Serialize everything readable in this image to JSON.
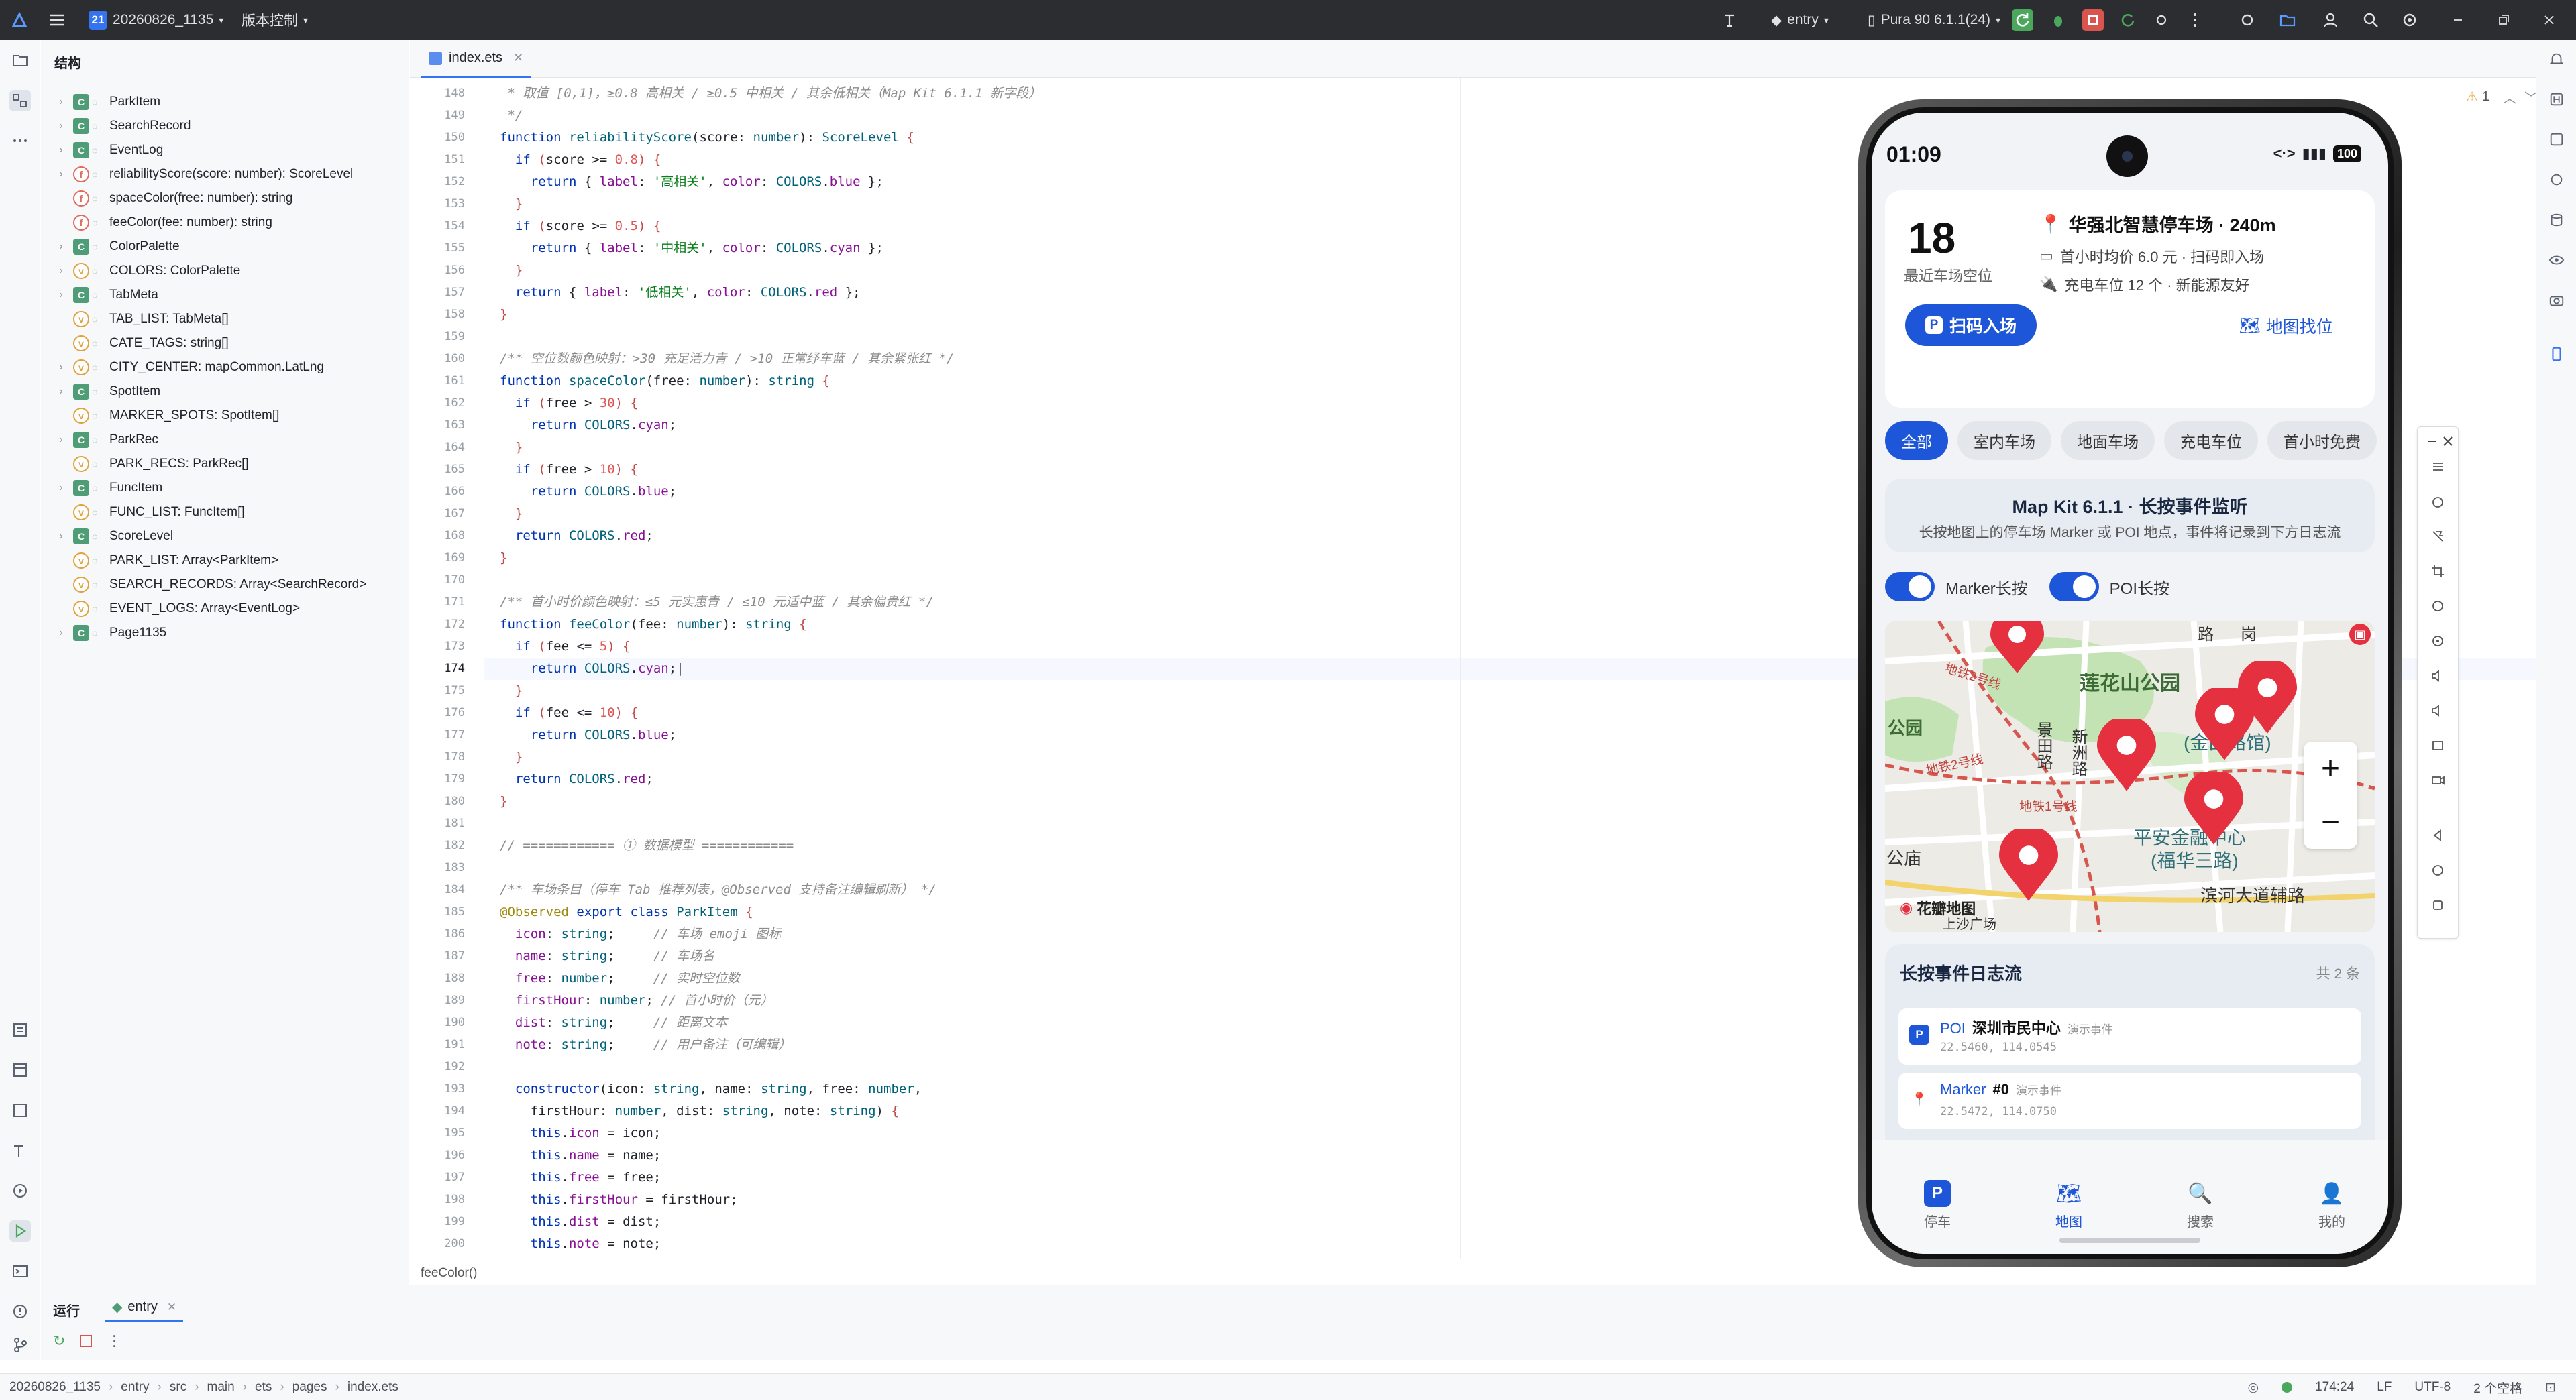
{
  "titlebar": {
    "project_badge": "21",
    "project_name": "20260826_1135",
    "vcs_label": "版本控制",
    "run_config": "entry",
    "device": "Pura 90 6.1.1(24)"
  },
  "structure": {
    "title": "结构",
    "items": [
      {
        "kind": "class",
        "expandable": true,
        "label": "ParkItem"
      },
      {
        "kind": "class",
        "expandable": true,
        "label": "SearchRecord"
      },
      {
        "kind": "class",
        "expandable": true,
        "label": "EventLog"
      },
      {
        "kind": "func",
        "expandable": true,
        "label": "reliabilityScore(score: number): ScoreLevel"
      },
      {
        "kind": "func",
        "expandable": false,
        "label": "spaceColor(free: number): string"
      },
      {
        "kind": "func",
        "expandable": false,
        "label": "feeColor(fee: number): string"
      },
      {
        "kind": "class",
        "expandable": true,
        "label": "ColorPalette"
      },
      {
        "kind": "var",
        "expandable": true,
        "label": "COLORS: ColorPalette"
      },
      {
        "kind": "class",
        "expandable": true,
        "label": "TabMeta"
      },
      {
        "kind": "var",
        "expandable": false,
        "label": "TAB_LIST: TabMeta[]"
      },
      {
        "kind": "var",
        "expandable": false,
        "label": "CATE_TAGS: string[]"
      },
      {
        "kind": "var",
        "expandable": true,
        "label": "CITY_CENTER: mapCommon.LatLng"
      },
      {
        "kind": "class",
        "expandable": true,
        "label": "SpotItem"
      },
      {
        "kind": "var",
        "expandable": false,
        "label": "MARKER_SPOTS: SpotItem[]"
      },
      {
        "kind": "class",
        "expandable": true,
        "label": "ParkRec"
      },
      {
        "kind": "var",
        "expandable": false,
        "label": "PARK_RECS: ParkRec[]"
      },
      {
        "kind": "class",
        "expandable": true,
        "label": "FuncItem"
      },
      {
        "kind": "var",
        "expandable": false,
        "label": "FUNC_LIST: FuncItem[]"
      },
      {
        "kind": "class",
        "expandable": true,
        "label": "ScoreLevel"
      },
      {
        "kind": "var",
        "expandable": false,
        "label": "PARK_LIST: Array<ParkItem>"
      },
      {
        "kind": "var",
        "expandable": false,
        "label": "SEARCH_RECORDS: Array<SearchRecord>"
      },
      {
        "kind": "var",
        "expandable": false,
        "label": "EVENT_LOGS: Array<EventLog>"
      },
      {
        "kind": "class",
        "expandable": true,
        "label": "Page1135"
      }
    ]
  },
  "editor": {
    "tab": "index.ets",
    "current_line": 174,
    "footer_hint": "feeColor()",
    "warning_count": "1",
    "lines": [
      {
        "n": 148,
        "html": "<span class=\"cm\"> * 取值 [0,1]，≥0.8 高相关 / ≥0.5 中相关 / 其余低相关（Map Kit 6.1.1 新字段）</span>"
      },
      {
        "n": 149,
        "html": "<span class=\"cm\"> */</span>"
      },
      {
        "n": 150,
        "html": "<span class=\"k\">function</span> <span class=\"fn\">reliabilityScore</span>(score: <span class=\"ty\">number</span>): <span class=\"ty\">ScoreLevel</span> <span class=\"bk\">{</span>"
      },
      {
        "n": 151,
        "html": "  <span class=\"k\">if</span> <span class=\"bk\">(</span>score &gt;= <span class=\"nm\">0.8</span><span class=\"bk\">)</span> <span class=\"bk\">{</span>"
      },
      {
        "n": 152,
        "html": "    <span class=\"k\">return</span> { <span class=\"pr\">label</span>: <span class=\"st\">'高相关'</span>, <span class=\"pr\">color</span>: <span class=\"ty\">COLORS</span>.<span class=\"pr\">blue</span> };"
      },
      {
        "n": 153,
        "html": "  <span class=\"bk\">}</span>"
      },
      {
        "n": 154,
        "html": "  <span class=\"k\">if</span> <span class=\"bk\">(</span>score &gt;= <span class=\"nm\">0.5</span><span class=\"bk\">)</span> <span class=\"bk\">{</span>"
      },
      {
        "n": 155,
        "html": "    <span class=\"k\">return</span> { <span class=\"pr\">label</span>: <span class=\"st\">'中相关'</span>, <span class=\"pr\">color</span>: <span class=\"ty\">COLORS</span>.<span class=\"pr\">cyan</span> };"
      },
      {
        "n": 156,
        "html": "  <span class=\"bk\">}</span>"
      },
      {
        "n": 157,
        "html": "  <span class=\"k\">return</span> { <span class=\"pr\">label</span>: <span class=\"st\">'低相关'</span>, <span class=\"pr\">color</span>: <span class=\"ty\">COLORS</span>.<span class=\"pr\">red</span> };"
      },
      {
        "n": 158,
        "html": "<span class=\"bk\">}</span>"
      },
      {
        "n": 159,
        "html": ""
      },
      {
        "n": 160,
        "html": "<span class=\"cm\">/** 空位数颜色映射：&gt;30 充足活力青 / &gt;10 正常纾车蓝 / 其余紧张红 */</span>"
      },
      {
        "n": 161,
        "html": "<span class=\"k\">function</span> <span class=\"fn\">spaceColor</span>(free: <span class=\"ty\">number</span>): <span class=\"ty\">string</span> <span class=\"bk\">{</span>"
      },
      {
        "n": 162,
        "html": "  <span class=\"k\">if</span> <span class=\"bk\">(</span>free &gt; <span class=\"nm\">30</span><span class=\"bk\">)</span> <span class=\"bk\">{</span>"
      },
      {
        "n": 163,
        "html": "    <span class=\"k\">return</span> <span class=\"ty\">COLORS</span>.<span class=\"pr\">cyan</span>;"
      },
      {
        "n": 164,
        "html": "  <span class=\"bk\">}</span>"
      },
      {
        "n": 165,
        "html": "  <span class=\"k\">if</span> <span class=\"bk\">(</span>free &gt; <span class=\"nm\">10</span><span class=\"bk\">)</span> <span class=\"bk\">{</span>"
      },
      {
        "n": 166,
        "html": "    <span class=\"k\">return</span> <span class=\"ty\">COLORS</span>.<span class=\"pr\">blue</span>;"
      },
      {
        "n": 167,
        "html": "  <span class=\"bk\">}</span>"
      },
      {
        "n": 168,
        "html": "  <span class=\"k\">return</span> <span class=\"ty\">COLORS</span>.<span class=\"pr\">red</span>;"
      },
      {
        "n": 169,
        "html": "<span class=\"bk\">}</span>"
      },
      {
        "n": 170,
        "html": ""
      },
      {
        "n": 171,
        "html": "<span class=\"cm\">/** 首小时价颜色映射：≤5 元实惠青 / ≤10 元适中蓝 / 其余偏贵红 */</span>"
      },
      {
        "n": 172,
        "html": "<span class=\"k\">function</span> <span class=\"fn\">feeColor</span>(fee: <span class=\"ty\">number</span>): <span class=\"ty\">string</span> <span class=\"bk\">{</span>"
      },
      {
        "n": 173,
        "html": "  <span class=\"k\">if</span> <span class=\"bk\">(</span>fee &lt;= <span class=\"nm\">5</span><span class=\"bk\">)</span> <span class=\"bk\">{</span>"
      },
      {
        "n": 174,
        "html": "    <span class=\"k\">return</span> <span class=\"ty\">COLORS</span>.<span class=\"pr\">cyan</span>;|"
      },
      {
        "n": 175,
        "html": "  <span class=\"bk\">}</span>"
      },
      {
        "n": 176,
        "html": "  <span class=\"k\">if</span> <span class=\"bk\">(</span>fee &lt;= <span class=\"nm\">10</span><span class=\"bk\">)</span> <span class=\"bk\">{</span>"
      },
      {
        "n": 177,
        "html": "    <span class=\"k\">return</span> <span class=\"ty\">COLORS</span>.<span class=\"pr\">blue</span>;"
      },
      {
        "n": 178,
        "html": "  <span class=\"bk\">}</span>"
      },
      {
        "n": 179,
        "html": "  <span class=\"k\">return</span> <span class=\"ty\">COLORS</span>.<span class=\"pr\">red</span>;"
      },
      {
        "n": 180,
        "html": "<span class=\"bk\">}</span>"
      },
      {
        "n": 181,
        "html": ""
      },
      {
        "n": 182,
        "html": "<span class=\"cm\">// ============ ① 数据模型 ============</span>"
      },
      {
        "n": 183,
        "html": ""
      },
      {
        "n": 184,
        "html": "<span class=\"cm\">/** 车场条目（停车 Tab 推荐列表，@Observed 支持备注编辑刷新） */</span>"
      },
      {
        "n": 185,
        "html": "<span class=\"dc\">@Observed</span> <span class=\"k\">export class</span> <span class=\"fn\">ParkItem</span> <span class=\"bk\">{</span>"
      },
      {
        "n": 186,
        "html": "  <span class=\"pr\">icon</span>: <span class=\"ty\">string</span>;     <span class=\"cm\">// 车场 emoji 图标</span>"
      },
      {
        "n": 187,
        "html": "  <span class=\"pr\">name</span>: <span class=\"ty\">string</span>;     <span class=\"cm\">// 车场名</span>"
      },
      {
        "n": 188,
        "html": "  <span class=\"pr\">free</span>: <span class=\"ty\">number</span>;     <span class=\"cm\">// 实时空位数</span>"
      },
      {
        "n": 189,
        "html": "  <span class=\"pr\">firstHour</span>: <span class=\"ty\">number</span>; <span class=\"cm\">// 首小时价（元）</span>"
      },
      {
        "n": 190,
        "html": "  <span class=\"pr\">dist</span>: <span class=\"ty\">string</span>;     <span class=\"cm\">// 距离文本</span>"
      },
      {
        "n": 191,
        "html": "  <span class=\"pr\">note</span>: <span class=\"ty\">string</span>;     <span class=\"cm\">// 用户备注（可编辑）</span>"
      },
      {
        "n": 192,
        "html": ""
      },
      {
        "n": 193,
        "html": "  <span class=\"k\">constructor</span>(icon: <span class=\"ty\">string</span>, name: <span class=\"ty\">string</span>, free: <span class=\"ty\">number</span>,"
      },
      {
        "n": 194,
        "html": "    firstHour: <span class=\"ty\">number</span>, dist: <span class=\"ty\">string</span>, note: <span class=\"ty\">string</span>) <span class=\"bk\">{</span>"
      },
      {
        "n": 195,
        "html": "    <span class=\"k\">this</span>.<span class=\"pr\">icon</span> = icon;"
      },
      {
        "n": 196,
        "html": "    <span class=\"k\">this</span>.<span class=\"pr\">name</span> = name;"
      },
      {
        "n": 197,
        "html": "    <span class=\"k\">this</span>.<span class=\"pr\">free</span> = free;"
      },
      {
        "n": 198,
        "html": "    <span class=\"k\">this</span>.<span class=\"pr\">firstHour</span> = firstHour;"
      },
      {
        "n": 199,
        "html": "    <span class=\"k\">this</span>.<span class=\"pr\">dist</span> = dist;"
      },
      {
        "n": 200,
        "html": "    <span class=\"k\">this</span>.<span class=\"pr\">note</span> = note;"
      }
    ]
  },
  "run": {
    "title": "运行",
    "tab": "entry"
  },
  "statusbar": {
    "crumbs": [
      "20260826_1135",
      "entry",
      "src",
      "main",
      "ets",
      "pages",
      "index.ets"
    ],
    "position": "174:24",
    "line_sep": "LF",
    "encoding": "UTF-8",
    "indent": "2 个空格"
  },
  "phone": {
    "time": "01:09",
    "battery": "100",
    "hero": {
      "free_count": "18",
      "free_label": "最近车场空位",
      "lot_name": "华强北智慧停车场 · 240m",
      "price_line": "首小时均价 6.0 元 · 扫码即入场",
      "charge_line": "充电车位 12 个 · 新能源友好",
      "scan_button": "扫码入场",
      "map_find": "地图找位"
    },
    "chips": [
      "全部",
      "室内车场",
      "地面车场",
      "充电车位",
      "首小时免费"
    ],
    "banner": {
      "title": "Map Kit 6.1.1 · 长按事件监听",
      "subtitle": "长按地图上的停车场 Marker 或 POI 地点，事件将记录到下方日志流"
    },
    "toggles": [
      "Marker长按",
      "POI长按"
    ],
    "map": {
      "labels": [
        "莲花山公园",
        "香蜜湖公园",
        "地铁2号线",
        "地铁1号线",
        "平安金融中心",
        "(福华三路)",
        "滨河大道辅路",
        "深圳美术馆",
        "(金田路馆)",
        "景田路",
        "新洲路",
        "上沙广场",
        "公庙",
        "岗",
        "路"
      ],
      "logo": "花瓣地图",
      "zoom_in": "+",
      "zoom_out": "−"
    },
    "log": {
      "title": "长按事件日志流",
      "count": "共 2 条",
      "items": [
        {
          "kind": "POI",
          "name": "深圳市民中心",
          "tag": "演示事件",
          "coords": "22.5460, 114.0545"
        },
        {
          "kind": "Marker",
          "name": "#0",
          "tag": "演示事件",
          "coords": "22.5472, 114.0750"
        }
      ]
    },
    "tabs": [
      {
        "label": "停车",
        "icon": "parking-icon"
      },
      {
        "label": "地图",
        "icon": "map-icon"
      },
      {
        "label": "搜索",
        "icon": "search-icon"
      },
      {
        "label": "我的",
        "icon": "user-icon"
      }
    ],
    "active_tab": "地图"
  },
  "colors": {
    "accent": "#1d56d8",
    "ide_accent": "#3574f0",
    "titlebar": "#2b2d30",
    "marker_red": "#e5303f"
  }
}
